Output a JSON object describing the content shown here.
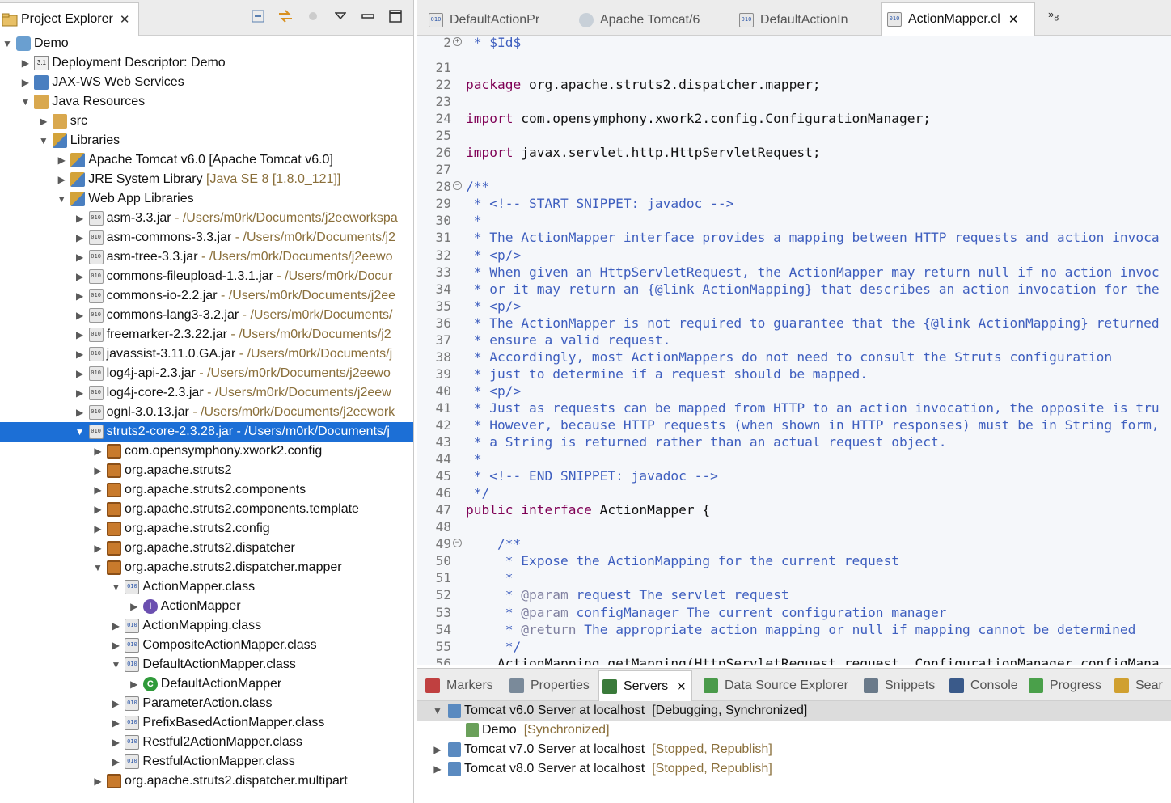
{
  "explorer": {
    "title": "Project Explorer",
    "tools": [
      "collapse-all-icon",
      "link-with-editor-icon",
      "focus-icon",
      "view-menu-icon",
      "minimize-icon",
      "maximize-icon"
    ]
  },
  "tree": [
    {
      "depth": 0,
      "expanded": true,
      "icon": "project-icon",
      "label": "Demo",
      "path": ""
    },
    {
      "depth": 1,
      "expanded": false,
      "icon": "deployment-descriptor-icon",
      "label": "Deployment Descriptor: Demo",
      "path": ""
    },
    {
      "depth": 1,
      "expanded": false,
      "icon": "web-services-icon",
      "label": "JAX-WS Web Services",
      "path": ""
    },
    {
      "depth": 1,
      "expanded": true,
      "icon": "java-resources-icon",
      "label": "Java Resources",
      "path": ""
    },
    {
      "depth": 2,
      "expanded": false,
      "icon": "source-folder-icon",
      "label": "src",
      "path": ""
    },
    {
      "depth": 2,
      "expanded": true,
      "icon": "library-icon",
      "label": "Libraries",
      "path": ""
    },
    {
      "depth": 3,
      "expanded": false,
      "icon": "library-icon",
      "label": "Apache Tomcat v6.0 [Apache Tomcat v6.0]",
      "path": ""
    },
    {
      "depth": 3,
      "expanded": false,
      "icon": "library-icon",
      "label": "JRE System Library",
      "path": "[Java SE 8 [1.8.0_121]]"
    },
    {
      "depth": 3,
      "expanded": true,
      "icon": "library-icon",
      "label": "Web App Libraries",
      "path": ""
    },
    {
      "depth": 4,
      "expanded": false,
      "icon": "jar-icon",
      "label": "asm-3.3.jar",
      "path": "- /Users/m0rk/Documents/j2eeworkspa"
    },
    {
      "depth": 4,
      "expanded": false,
      "icon": "jar-icon",
      "label": "asm-commons-3.3.jar",
      "path": "- /Users/m0rk/Documents/j2"
    },
    {
      "depth": 4,
      "expanded": false,
      "icon": "jar-icon",
      "label": "asm-tree-3.3.jar",
      "path": "- /Users/m0rk/Documents/j2eewo"
    },
    {
      "depth": 4,
      "expanded": false,
      "icon": "jar-icon",
      "label": "commons-fileupload-1.3.1.jar",
      "path": "- /Users/m0rk/Docur"
    },
    {
      "depth": 4,
      "expanded": false,
      "icon": "jar-icon",
      "label": "commons-io-2.2.jar",
      "path": "- /Users/m0rk/Documents/j2ee"
    },
    {
      "depth": 4,
      "expanded": false,
      "icon": "jar-icon",
      "label": "commons-lang3-3.2.jar",
      "path": "- /Users/m0rk/Documents/"
    },
    {
      "depth": 4,
      "expanded": false,
      "icon": "jar-icon",
      "label": "freemarker-2.3.22.jar",
      "path": "- /Users/m0rk/Documents/j2"
    },
    {
      "depth": 4,
      "expanded": false,
      "icon": "jar-icon",
      "label": "javassist-3.11.0.GA.jar",
      "path": "- /Users/m0rk/Documents/j"
    },
    {
      "depth": 4,
      "expanded": false,
      "icon": "jar-icon",
      "label": "log4j-api-2.3.jar",
      "path": "- /Users/m0rk/Documents/j2eewo"
    },
    {
      "depth": 4,
      "expanded": false,
      "icon": "jar-icon",
      "label": "log4j-core-2.3.jar",
      "path": "- /Users/m0rk/Documents/j2eew"
    },
    {
      "depth": 4,
      "expanded": false,
      "icon": "jar-icon",
      "label": "ognl-3.0.13.jar",
      "path": "- /Users/m0rk/Documents/j2eework"
    },
    {
      "depth": 4,
      "expanded": true,
      "icon": "jar-icon",
      "label": "struts2-core-2.3.28.jar",
      "path": "- /Users/m0rk/Documents/j",
      "selected": true
    },
    {
      "depth": 5,
      "expanded": false,
      "icon": "package-icon",
      "label": "com.opensymphony.xwork2.config",
      "path": ""
    },
    {
      "depth": 5,
      "expanded": false,
      "icon": "package-icon",
      "label": "org.apache.struts2",
      "path": ""
    },
    {
      "depth": 5,
      "expanded": false,
      "icon": "package-icon",
      "label": "org.apache.struts2.components",
      "path": ""
    },
    {
      "depth": 5,
      "expanded": false,
      "icon": "package-icon",
      "label": "org.apache.struts2.components.template",
      "path": ""
    },
    {
      "depth": 5,
      "expanded": false,
      "icon": "package-icon",
      "label": "org.apache.struts2.config",
      "path": ""
    },
    {
      "depth": 5,
      "expanded": false,
      "icon": "package-icon",
      "label": "org.apache.struts2.dispatcher",
      "path": ""
    },
    {
      "depth": 5,
      "expanded": true,
      "icon": "package-icon",
      "label": "org.apache.struts2.dispatcher.mapper",
      "path": ""
    },
    {
      "depth": 6,
      "expanded": true,
      "icon": "class-file-icon",
      "label": "ActionMapper.class",
      "path": ""
    },
    {
      "depth": 7,
      "expanded": false,
      "icon": "interface-icon",
      "label": "ActionMapper",
      "path": ""
    },
    {
      "depth": 6,
      "expanded": false,
      "icon": "class-file-icon",
      "label": "ActionMapping.class",
      "path": ""
    },
    {
      "depth": 6,
      "expanded": false,
      "icon": "class-file-icon",
      "label": "CompositeActionMapper.class",
      "path": ""
    },
    {
      "depth": 6,
      "expanded": true,
      "icon": "class-file-icon",
      "label": "DefaultActionMapper.class",
      "path": ""
    },
    {
      "depth": 7,
      "expanded": false,
      "icon": "class-icon",
      "label": "DefaultActionMapper",
      "path": ""
    },
    {
      "depth": 6,
      "expanded": false,
      "icon": "class-file-icon",
      "label": "ParameterAction.class",
      "path": ""
    },
    {
      "depth": 6,
      "expanded": false,
      "icon": "class-file-icon",
      "label": "PrefixBasedActionMapper.class",
      "path": ""
    },
    {
      "depth": 6,
      "expanded": false,
      "icon": "class-file-icon",
      "label": "Restful2ActionMapper.class",
      "path": ""
    },
    {
      "depth": 6,
      "expanded": false,
      "icon": "class-file-icon",
      "label": "RestfulActionMapper.class",
      "path": ""
    },
    {
      "depth": 5,
      "expanded": false,
      "icon": "package-icon",
      "label": "org.apache.struts2.dispatcher.multipart",
      "path": ""
    }
  ],
  "editor": {
    "tabs": [
      {
        "label": "DefaultActionPr",
        "icon": "class-file-icon",
        "active": false
      },
      {
        "label": "Apache Tomcat/6",
        "icon": "globe-icon",
        "active": false
      },
      {
        "label": "DefaultActionIn",
        "icon": "class-file-icon",
        "active": false
      },
      {
        "label": "ActionMapper.cl",
        "icon": "class-file-icon",
        "active": true
      }
    ],
    "overflow_count": "8",
    "lines": [
      {
        "n": "2",
        "fold": "+",
        "t": " * $Id$",
        "k": "cm"
      },
      {
        "n": "21",
        "fold": "",
        "t": "",
        "k": ""
      },
      {
        "n": "22",
        "fold": "",
        "t": "package org.apache.struts2.dispatcher.mapper;",
        "k": "pkg"
      },
      {
        "n": "23",
        "fold": "",
        "t": "",
        "k": ""
      },
      {
        "n": "24",
        "fold": "",
        "t": "import com.opensymphony.xwork2.config.ConfigurationManager;",
        "k": "imp"
      },
      {
        "n": "25",
        "fold": "",
        "t": "",
        "k": ""
      },
      {
        "n": "26",
        "fold": "",
        "t": "import javax.servlet.http.HttpServletRequest;",
        "k": "imp"
      },
      {
        "n": "27",
        "fold": "",
        "t": "",
        "k": ""
      },
      {
        "n": "28",
        "fold": "-",
        "t": "/**",
        "k": "cm"
      },
      {
        "n": "29",
        "fold": "",
        "t": " * <!-- START SNIPPET: javadoc -->",
        "k": "cm"
      },
      {
        "n": "30",
        "fold": "",
        "t": " *",
        "k": "cm"
      },
      {
        "n": "31",
        "fold": "",
        "t": " * The ActionMapper interface provides a mapping between HTTP requests and action invoca",
        "k": "cm"
      },
      {
        "n": "32",
        "fold": "",
        "t": " * <p/>",
        "k": "cm"
      },
      {
        "n": "33",
        "fold": "",
        "t": " * When given an HttpServletRequest, the ActionMapper may return null if no action invoc",
        "k": "cm"
      },
      {
        "n": "34",
        "fold": "",
        "t": " * or it may return an {@link ActionMapping} that describes an action invocation for the",
        "k": "cm"
      },
      {
        "n": "35",
        "fold": "",
        "t": " * <p/>",
        "k": "cm"
      },
      {
        "n": "36",
        "fold": "",
        "t": " * The ActionMapper is not required to guarantee that the {@link ActionMapping} returned",
        "k": "cm"
      },
      {
        "n": "37",
        "fold": "",
        "t": " * ensure a valid request.",
        "k": "cm"
      },
      {
        "n": "38",
        "fold": "",
        "t": " * Accordingly, most ActionMappers do not need to consult the Struts configuration",
        "k": "cm"
      },
      {
        "n": "39",
        "fold": "",
        "t": " * just to determine if a request should be mapped.",
        "k": "cm"
      },
      {
        "n": "40",
        "fold": "",
        "t": " * <p/>",
        "k": "cm"
      },
      {
        "n": "41",
        "fold": "",
        "t": " * Just as requests can be mapped from HTTP to an action invocation, the opposite is tru",
        "k": "cm"
      },
      {
        "n": "42",
        "fold": "",
        "t": " * However, because HTTP requests (when shown in HTTP responses) must be in String form,",
        "k": "cm"
      },
      {
        "n": "43",
        "fold": "",
        "t": " * a String is returned rather than an actual request object.",
        "k": "cm"
      },
      {
        "n": "44",
        "fold": "",
        "t": " *",
        "k": "cm"
      },
      {
        "n": "45",
        "fold": "",
        "t": " * <!-- END SNIPPET: javadoc -->",
        "k": "cm"
      },
      {
        "n": "46",
        "fold": "",
        "t": " */",
        "k": "cm"
      },
      {
        "n": "47",
        "fold": "",
        "t": "public interface ActionMapper {",
        "k": "decl"
      },
      {
        "n": "48",
        "fold": "",
        "t": "",
        "k": ""
      },
      {
        "n": "49",
        "fold": "-",
        "t": "    /**",
        "k": "cm"
      },
      {
        "n": "50",
        "fold": "",
        "t": "     * Expose the ActionMapping for the current request",
        "k": "cm"
      },
      {
        "n": "51",
        "fold": "",
        "t": "     *",
        "k": "cm"
      },
      {
        "n": "52",
        "fold": "",
        "t": "     * @param request The servlet request",
        "k": "cm"
      },
      {
        "n": "53",
        "fold": "",
        "t": "     * @param configManager The current configuration manager",
        "k": "cm"
      },
      {
        "n": "54",
        "fold": "",
        "t": "     * @return The appropriate action mapping or null if mapping cannot be determined",
        "k": "cm"
      },
      {
        "n": "55",
        "fold": "",
        "t": "     */",
        "k": "cm"
      },
      {
        "n": "56",
        "fold": "",
        "t": "    ActionMapping getMapping(HttpServletRequest request, ConfigurationManager configMana",
        "k": "plain"
      }
    ]
  },
  "bottom": {
    "tabs": [
      {
        "label": "Markers",
        "icon": "markers-icon",
        "active": false
      },
      {
        "label": "Properties",
        "icon": "properties-icon",
        "active": false
      },
      {
        "label": "Servers",
        "icon": "servers-icon",
        "active": true
      },
      {
        "label": "Data Source Explorer",
        "icon": "data-source-icon",
        "active": false
      },
      {
        "label": "Snippets",
        "icon": "snippets-icon",
        "active": false
      },
      {
        "label": "Console",
        "icon": "console-icon",
        "active": false
      },
      {
        "label": "Progress",
        "icon": "progress-icon",
        "active": false
      },
      {
        "label": "Sear",
        "icon": "search-icon",
        "active": false
      }
    ],
    "servers": [
      {
        "depth": 0,
        "expanded": true,
        "name": "Tomcat v6.0 Server at localhost",
        "status": "[Debugging, Synchronized]",
        "selected": true,
        "status_plain": true
      },
      {
        "depth": 1,
        "expanded": null,
        "name": "Demo",
        "status": "[Synchronized]",
        "selected": false,
        "status_plain": false
      },
      {
        "depth": 0,
        "expanded": false,
        "name": "Tomcat v7.0 Server at localhost",
        "status": "[Stopped, Republish]",
        "selected": false,
        "status_plain": false
      },
      {
        "depth": 0,
        "expanded": false,
        "name": "Tomcat v8.0 Server at localhost",
        "status": "[Stopped, Republish]",
        "selected": false,
        "status_plain": false
      }
    ]
  },
  "colors": {
    "selection": "#1c6fd6",
    "keyword": "#7f0055",
    "javadoc": "#3f5fbf",
    "decoration": "#8a6f3b"
  }
}
